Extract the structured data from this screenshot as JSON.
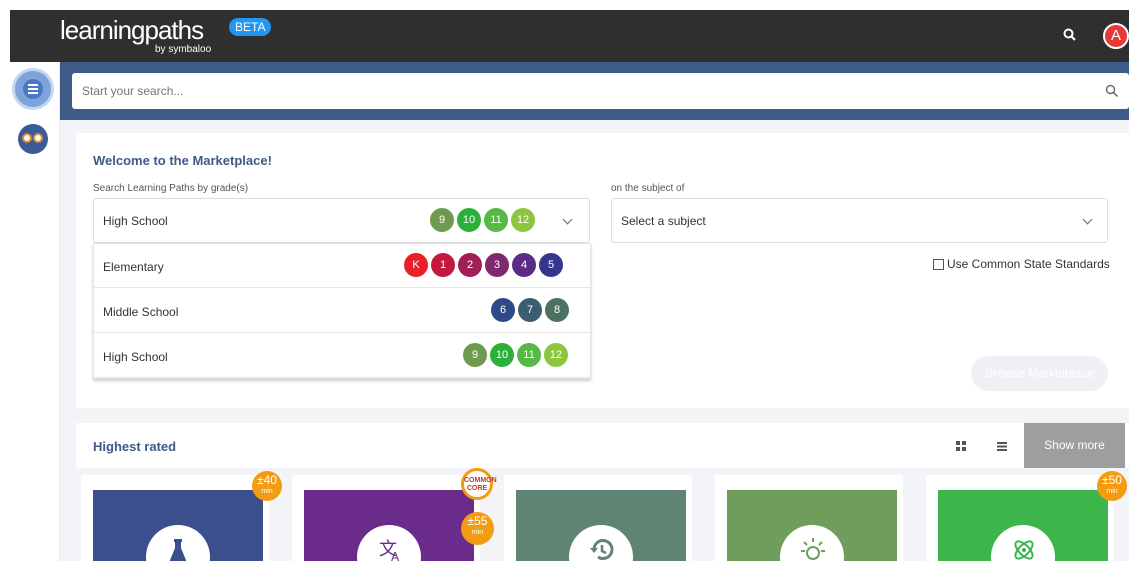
{
  "header": {
    "logo_main": "learningpaths",
    "logo_sub": "by symbaloo",
    "beta_label": "BETA",
    "avatar_letter": "A"
  },
  "search": {
    "placeholder": "Start your search..."
  },
  "welcome": {
    "title": "Welcome to the Marketplace!",
    "grade_label": "Search Learning Paths by grade(s)",
    "subject_label": "on the subject of",
    "selected_grade": "High School",
    "selected_grades": [
      "9",
      "10",
      "11",
      "12"
    ],
    "subject_value": "Select a subject",
    "standards_label": "Use Common State Standards",
    "browse_label": "Browse Marketplace"
  },
  "grade_options": [
    {
      "label": "Elementary",
      "grades": [
        "K",
        "1",
        "2",
        "3",
        "4",
        "5"
      ]
    },
    {
      "label": "Middle School",
      "grades": [
        "6",
        "7",
        "8"
      ]
    },
    {
      "label": "High School",
      "grades": [
        "9",
        "10",
        "11",
        "12"
      ]
    }
  ],
  "grade_colors": {
    "K": "#e8202a",
    "1": "#c4183f",
    "2": "#a21e56",
    "3": "#7e2a6d",
    "4": "#5a2c86",
    "5": "#35358e",
    "6": "#2e4a86",
    "7": "#3a5d6f",
    "8": "#4d7160",
    "9": "#6d9a4e",
    "10": "#2bb03a",
    "11": "#55b944",
    "12": "#8cc63f"
  },
  "highest_rated": {
    "title": "Highest rated",
    "show_more_label": "Show more"
  },
  "cards": [
    {
      "color": "#3a4f8c",
      "icon": "flask-icon",
      "duration": "±40",
      "unit": "min"
    },
    {
      "color": "#6a2b8a",
      "icon": "translate-icon",
      "duration": "±55",
      "unit": "min",
      "common_core": [
        "COMMON",
        "CORE"
      ]
    },
    {
      "color": "#5f8572",
      "icon": "history-icon"
    },
    {
      "color": "#6f9e5c",
      "icon": "lightbulb-icon"
    },
    {
      "color": "#3cb54a",
      "icon": "atom-icon",
      "duration": "±50",
      "unit": "min"
    }
  ]
}
